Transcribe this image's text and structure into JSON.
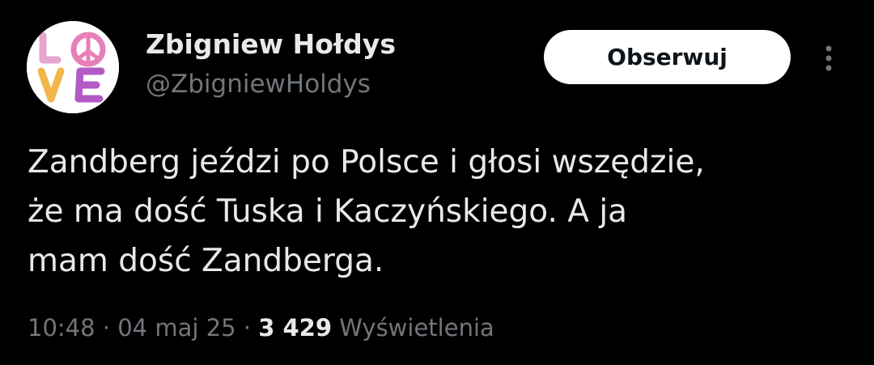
{
  "author": {
    "display_name": "Zbigniew Hołdys",
    "handle": "@ZbigniewHoldys",
    "avatar_text": "LOVE"
  },
  "actions": {
    "follow_label": "Obserwuj",
    "more_icon": "more-vertical-icon"
  },
  "tweet": {
    "text": "Zandberg jeździ po Polsce i głosi wszędzie,\nże ma dość Tuska i Kaczyńskiego. A ja\nmam dość Zandberga.",
    "time": "10:48",
    "date": "04 maj 25",
    "separator": " · ",
    "views_count": "3 429",
    "views_label": "Wyświetlenia"
  },
  "colors": {
    "background": "#000000",
    "primary_text": "#e7e9ea",
    "secondary_text": "#71767b",
    "button_bg": "#ffffff"
  }
}
